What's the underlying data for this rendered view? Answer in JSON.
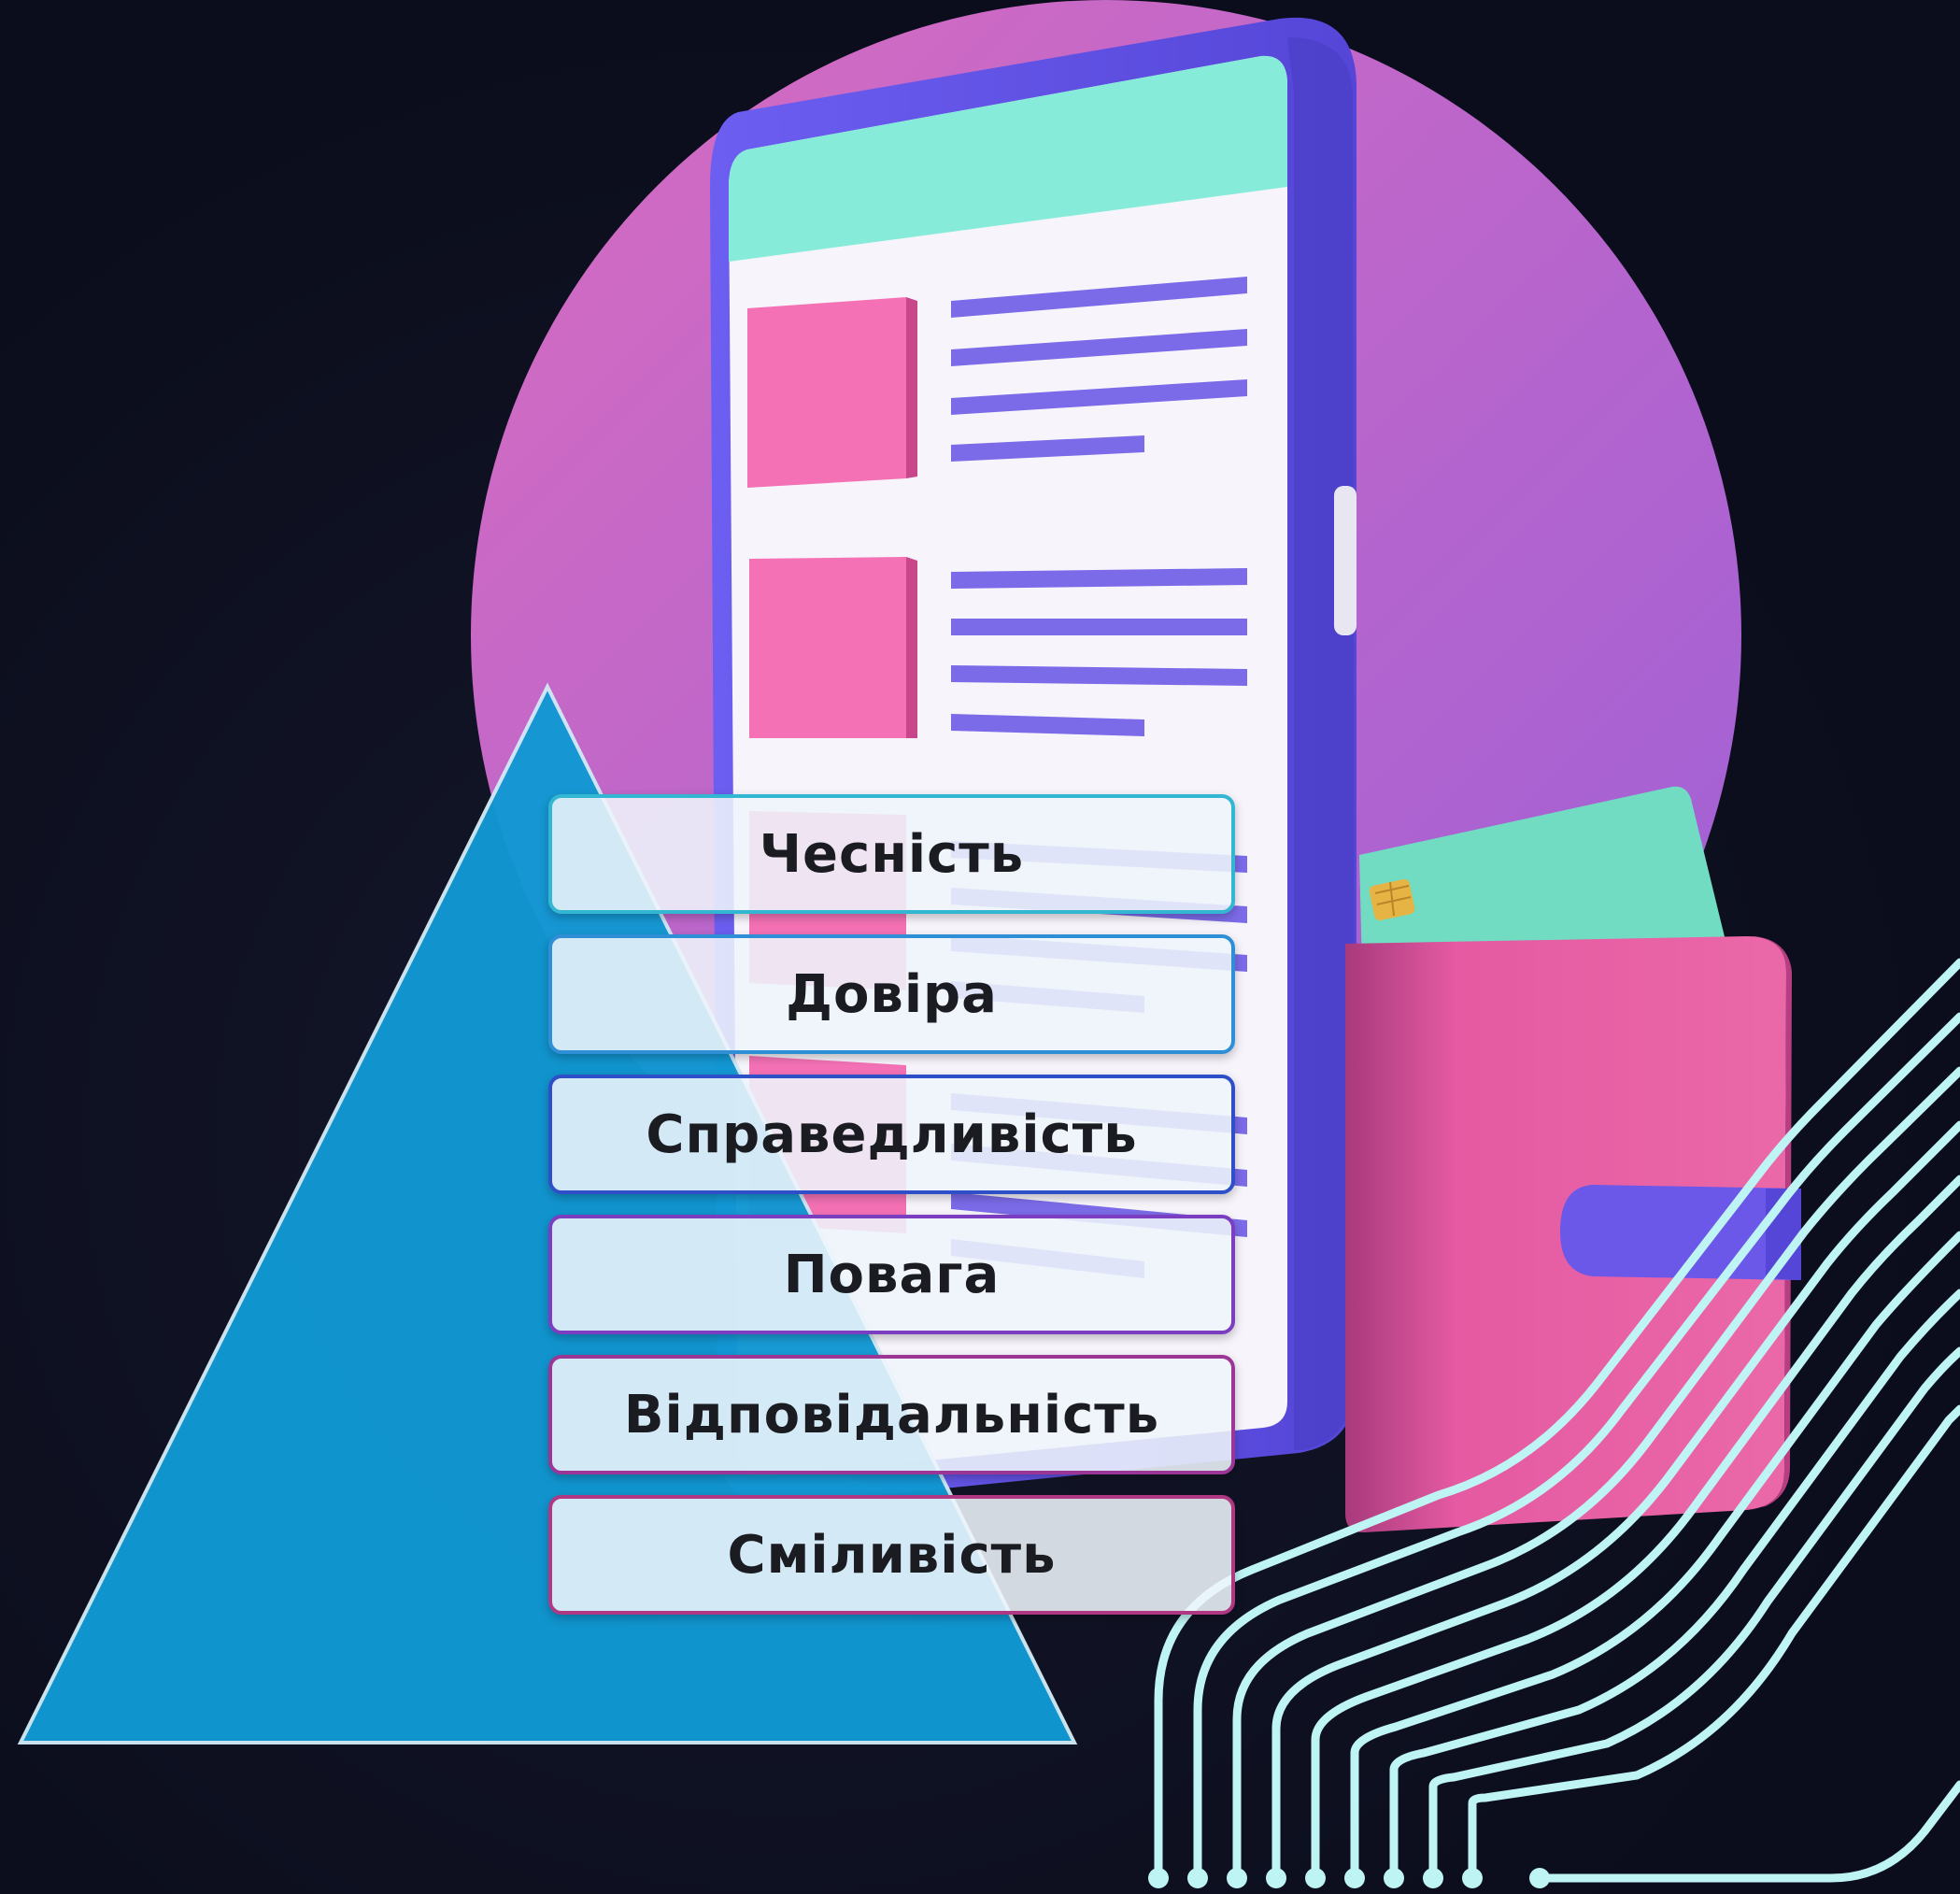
{
  "values": [
    {
      "label": "Чесність",
      "color": "#33b6d2"
    },
    {
      "label": "Довіра",
      "color": "#2f8fd6"
    },
    {
      "label": "Справедливість",
      "color": "#2e4fc8"
    },
    {
      "label": "Повага",
      "color": "#7b3ec0"
    },
    {
      "label": "Відповідальність",
      "color": "#9b3596"
    },
    {
      "label": "Сміливість",
      "color": "#b03882"
    }
  ],
  "colors": {
    "background": "#0b0d1c",
    "circle": "#c46ad0",
    "pyramid": "#1199d4",
    "phone_body": "#6e5ff0",
    "phone_header": "#86ecd9",
    "content_block": "#f471b5",
    "content_line": "#7b6be8",
    "wallet": "#e85aa2",
    "wallet_clasp": "#6b57e8",
    "card": "#72dcc3",
    "circuit_lines": "#bff4f4"
  }
}
